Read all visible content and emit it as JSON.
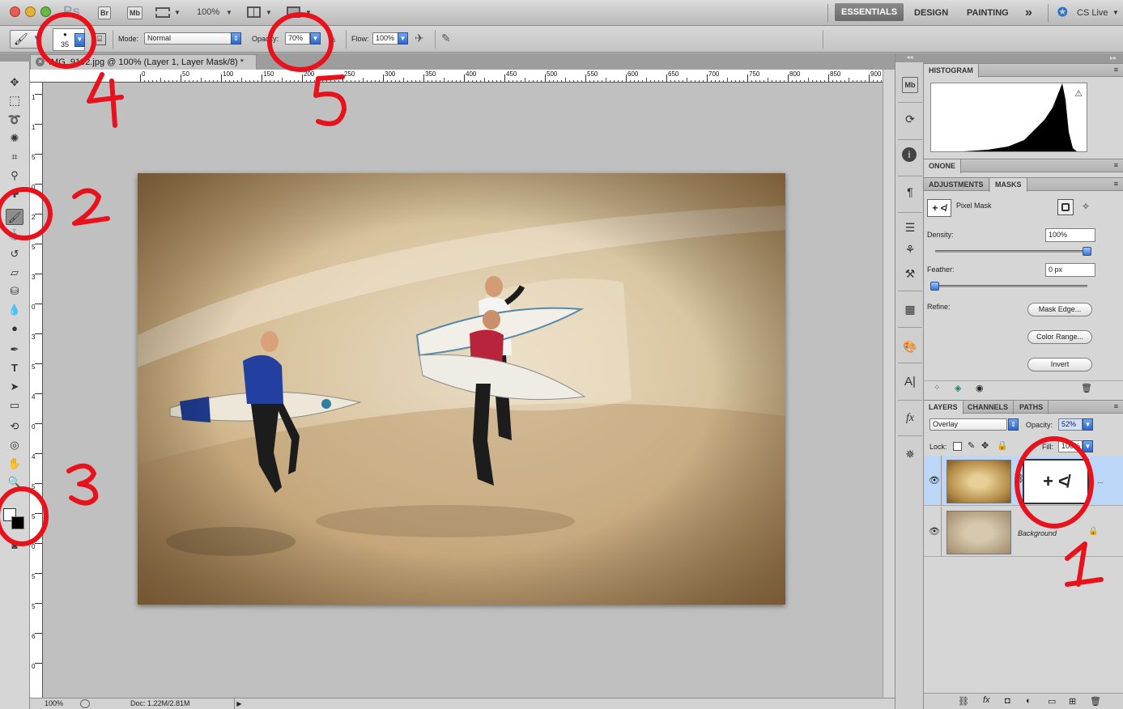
{
  "app": {
    "logo": "Ps",
    "bridge": "Br",
    "minibridge": "Mb",
    "zoom": "100%",
    "workspaces": [
      "ESSENTIALS",
      "DESIGN",
      "PAINTING"
    ],
    "more": "»",
    "cslive": "CS Live"
  },
  "options": {
    "brush_size": "35",
    "mode_label": "Mode:",
    "mode_value": "Normal",
    "opacity_label": "Opacity:",
    "opacity_value": "70%",
    "flow_label": "Flow:",
    "flow_value": "100%"
  },
  "document": {
    "tab_title": "IMG_9192.jpg @ 100% (Layer 1, Layer Mask/8) *",
    "status_zoom": "100%",
    "status_doc": "Doc: 1.22M/2.81M"
  },
  "ruler": {
    "h_labels": [
      "0",
      "50",
      "100",
      "150",
      "200",
      "250",
      "300",
      "350",
      "400",
      "450",
      "500",
      "550",
      "600",
      "650",
      "700",
      "750",
      "800",
      "850",
      "900"
    ],
    "v_labels": [
      "1",
      "1",
      "5",
      "0",
      "2",
      "5",
      "3",
      "0",
      "3",
      "5",
      "4",
      "0",
      "4",
      "5",
      "5",
      "0",
      "5",
      "5",
      "6",
      "0"
    ]
  },
  "panels": {
    "histogram": "HISTOGRAM",
    "onone": "ONONE",
    "adjustments_tab": "ADJUSTMENTS",
    "masks_tab": "MASKS",
    "pixel_mask": "Pixel Mask",
    "density_label": "Density:",
    "density_value": "100%",
    "density_level": 1.0,
    "feather_label": "Feather:",
    "feather_value": "0 px",
    "feather_level": 0.0,
    "refine_label": "Refine:",
    "mask_edge": "Mask Edge...",
    "color_range": "Color Range...",
    "invert": "Invert",
    "layers_tab": "LAYERS",
    "channels_tab": "CHANNELS",
    "paths_tab": "PATHS",
    "blend_mode": "Overlay",
    "opacity_label": "Opacity:",
    "opacity_value": "52%",
    "lock_label": "Lock:",
    "fill_label": "Fill:",
    "fill_value": "100%",
    "layer_background": "Background"
  },
  "annotations": [
    "1",
    "2",
    "3",
    "4",
    "5"
  ],
  "colors": {
    "annotation": "#e8121c",
    "selected_layer": "#bcd6f7",
    "ui_gray": "#d6d6d6"
  }
}
